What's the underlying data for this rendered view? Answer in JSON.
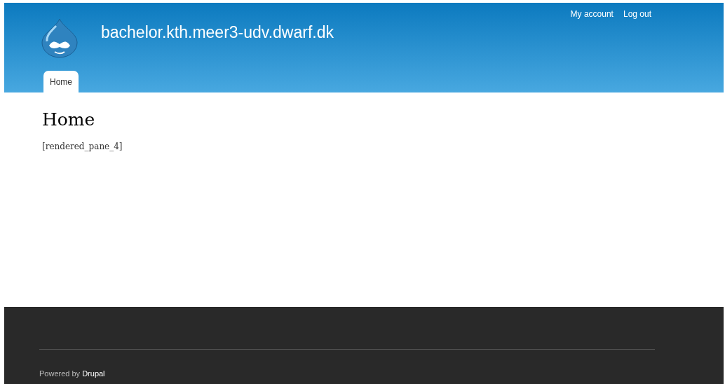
{
  "header": {
    "site_name": "bachelor.kth.meer3-udv.dwarf.dk",
    "secondary_menu": [
      {
        "label": "My account"
      },
      {
        "label": "Log out"
      }
    ],
    "tabs": [
      {
        "label": "Home",
        "selected": true
      }
    ]
  },
  "content": {
    "title": "Home",
    "body": "[rendered_pane_4]"
  },
  "footer": {
    "text": "Powered by",
    "link": "Drupal"
  }
}
